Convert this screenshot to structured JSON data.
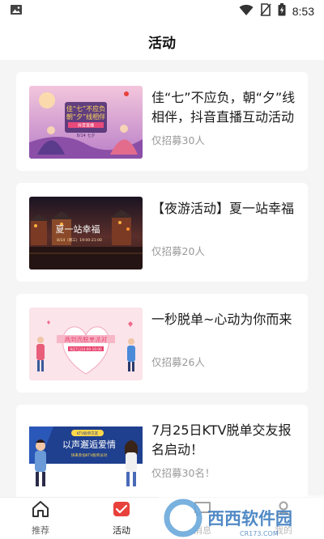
{
  "status_bar": {
    "time": "8:53",
    "icons": [
      "image-icon",
      "wifi-icon",
      "no-sim-icon",
      "battery-charging-icon"
    ]
  },
  "header": {
    "title": "活动"
  },
  "activities": [
    {
      "title": "佳“七”不应负，朝“夕”线相伴，抖音直播互动活动",
      "quota": "仅招募30人",
      "thumb": {
        "headline1": "佳“七”不应负",
        "headline2": "朝“夕”线相伴",
        "sub": "抖音直播",
        "date": "8/14 七夕"
      }
    },
    {
      "title": "【夜游活动】夏一站幸福",
      "quota": "仅招募20人",
      "thumb": {
        "headline": "夏一站幸福",
        "date": "8/14（周三）19:00-21:00"
      }
    },
    {
      "title": "一秒脱单~心动为你而来",
      "quota": "仅招募26人",
      "thumb": {
        "headline": "两到而脱单派对",
        "date": "8月7日14:00-16:00"
      }
    },
    {
      "title": "7月25日KTV脱单交友报名启动！",
      "quota": "仅招募30名！",
      "thumb": {
        "headline": "以声邂逅爱情",
        "badge": "KTV脱单交友",
        "sub": "快来参加KTV脱单派对"
      }
    }
  ],
  "tab_bar": {
    "tabs": [
      {
        "label": "推荐",
        "icon": "home-icon",
        "active": false
      },
      {
        "label": "活动",
        "icon": "activity-icon",
        "active": true
      },
      {
        "label": "消息",
        "icon": "message-icon",
        "active": false
      },
      {
        "label": "我的",
        "icon": "profile-icon",
        "active": false
      }
    ]
  },
  "watermark": {
    "text": "西西软件园",
    "sub": "CR173.COM"
  },
  "colors": {
    "accent": "#e8413c",
    "card_bg": "#ffffff",
    "page_bg": "#f5f5f5",
    "muted": "#999999"
  }
}
